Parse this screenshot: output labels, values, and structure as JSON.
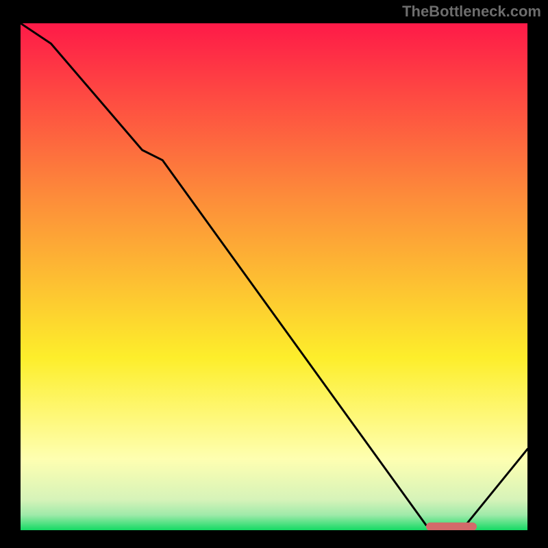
{
  "watermark": "TheBottleneck.com",
  "colors": {
    "bg_black": "#000000",
    "grad_top": "#fe1a48",
    "grad_mid1": "#fd8b3a",
    "grad_mid2": "#fdee2b",
    "grad_low": "#feffb1",
    "grad_green_light": "#9feaa9",
    "grad_green": "#14da64",
    "line": "#000000",
    "marker": "#d36a6a"
  },
  "chart_data": {
    "type": "line",
    "title": "",
    "xlabel": "",
    "ylabel": "",
    "xlim": [
      0,
      100
    ],
    "ylim": [
      0,
      100
    ],
    "series": [
      {
        "name": "bottleneck-curve",
        "x": [
          0,
          6,
          24,
          28,
          80,
          84,
          87,
          100
        ],
        "values": [
          100,
          96,
          75,
          73,
          1,
          0,
          0,
          16
        ]
      }
    ],
    "annotations": [
      {
        "name": "optimal-range",
        "type": "bar",
        "x0": 80,
        "x1": 90,
        "y": 0.7
      }
    ]
  }
}
